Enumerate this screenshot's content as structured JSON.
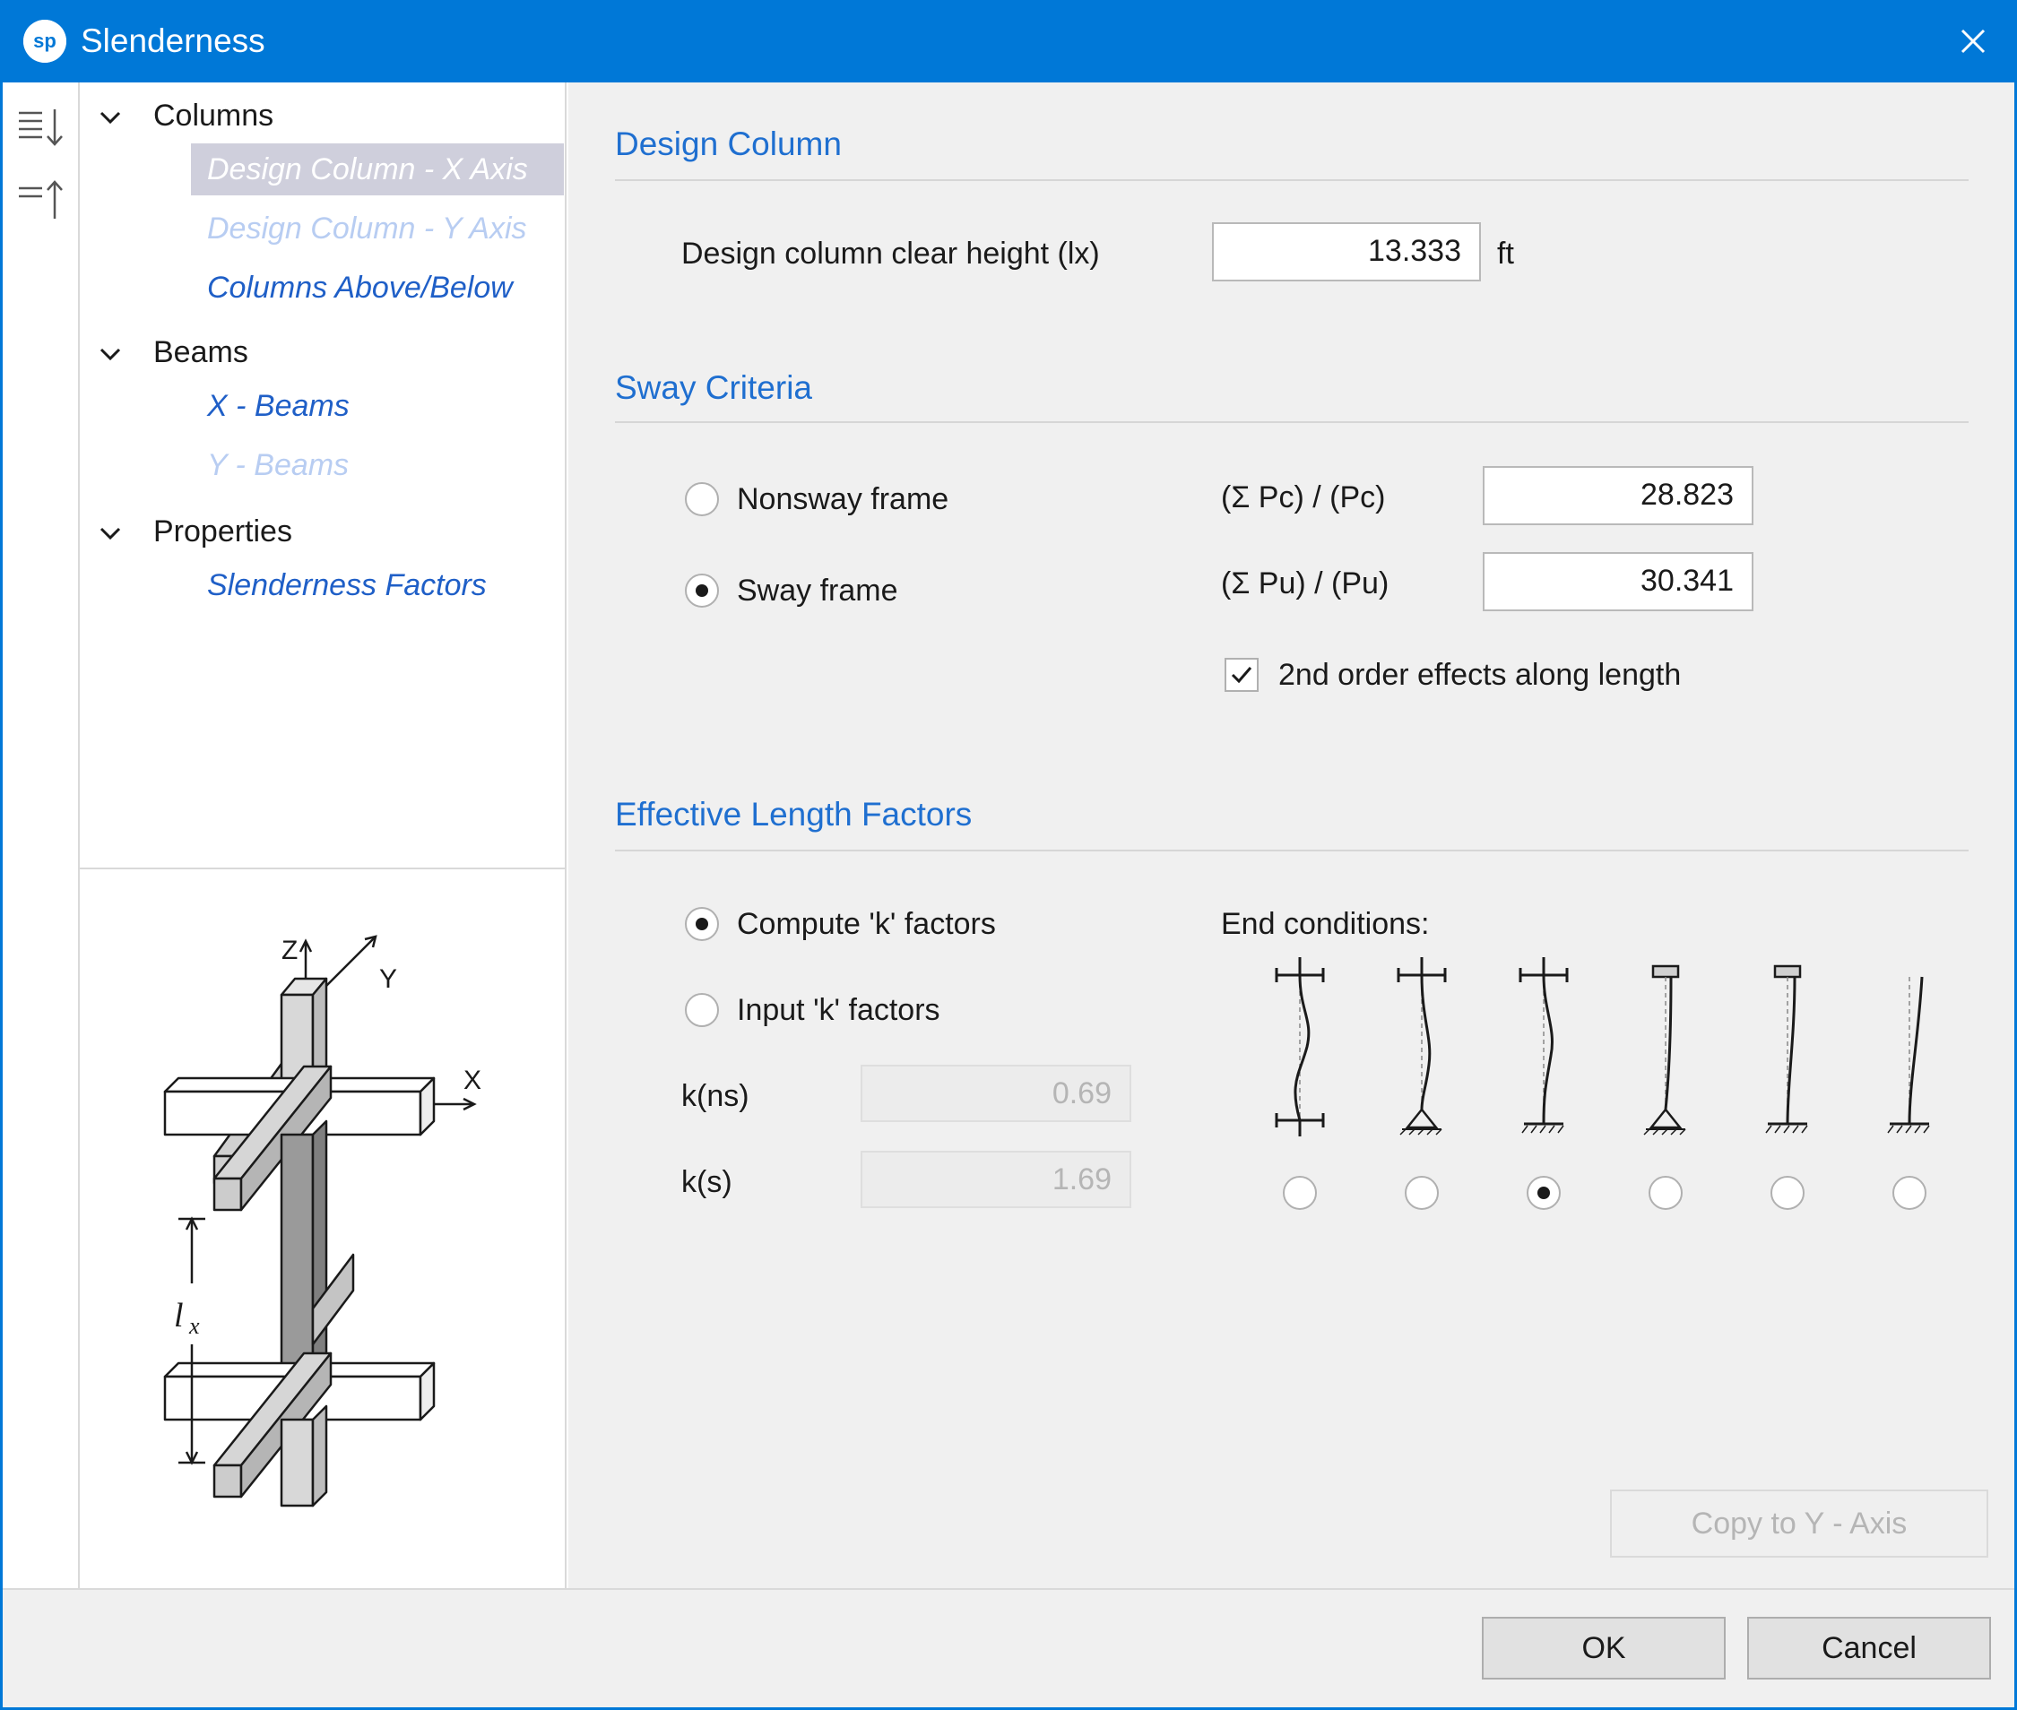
{
  "window": {
    "title": "Slenderness",
    "logo_text": "sp",
    "close_icon": "close-icon"
  },
  "toolbar": {
    "buttons": [
      {
        "icon": "expand-all-icon"
      },
      {
        "icon": "collapse-all-icon"
      }
    ]
  },
  "tree": {
    "groups": [
      {
        "label": "Columns",
        "items": [
          {
            "label": "Design Column - X Axis",
            "state": "selected"
          },
          {
            "label": "Design Column - Y Axis",
            "state": "disabled"
          },
          {
            "label": "Columns Above/Below",
            "state": "normal"
          }
        ]
      },
      {
        "label": "Beams",
        "items": [
          {
            "label": "X - Beams",
            "state": "normal"
          },
          {
            "label": "Y - Beams",
            "state": "disabled"
          }
        ]
      },
      {
        "label": "Properties",
        "items": [
          {
            "label": "Slenderness Factors",
            "state": "normal"
          }
        ]
      }
    ]
  },
  "diagram": {
    "axis_z": "Z",
    "axis_y": "Y",
    "axis_x": "X",
    "length_label": "l",
    "length_subscript": "x"
  },
  "design_column": {
    "title": "Design Column",
    "height_label": "Design column clear height (lx)",
    "height_value": "13.333",
    "height_unit": "ft"
  },
  "sway_criteria": {
    "title": "Sway Criteria",
    "nonsway_label": "Nonsway frame",
    "sway_label": "Sway frame",
    "selected": "sway",
    "pc_label": "(Σ Pc) / (Pc)",
    "pc_value": "28.823",
    "pu_label": "(Σ Pu) / (Pu)",
    "pu_value": "30.341",
    "second_order_label": "2nd order effects along length",
    "second_order_checked": true
  },
  "effective_length": {
    "title": "Effective Length Factors",
    "compute_label": "Compute 'k' factors",
    "input_label": "Input 'k' factors",
    "selected": "compute",
    "kns_label": "k(ns)",
    "kns_value": "0.69",
    "ks_label": "k(s)",
    "ks_value": "1.69",
    "end_conditions_label": "End conditions:",
    "end_conditions": [
      {
        "icon": "fixed-fixed-icon",
        "selected": false
      },
      {
        "icon": "fixed-pinned-icon",
        "selected": false
      },
      {
        "icon": "fixed-fixed-base-icon",
        "selected": true
      },
      {
        "icon": "guided-pinned-icon",
        "selected": false
      },
      {
        "icon": "guided-fixed-icon",
        "selected": false
      },
      {
        "icon": "free-fixed-icon",
        "selected": false
      }
    ]
  },
  "buttons": {
    "copy_label": "Copy to Y - Axis",
    "ok_label": "OK",
    "cancel_label": "Cancel"
  }
}
